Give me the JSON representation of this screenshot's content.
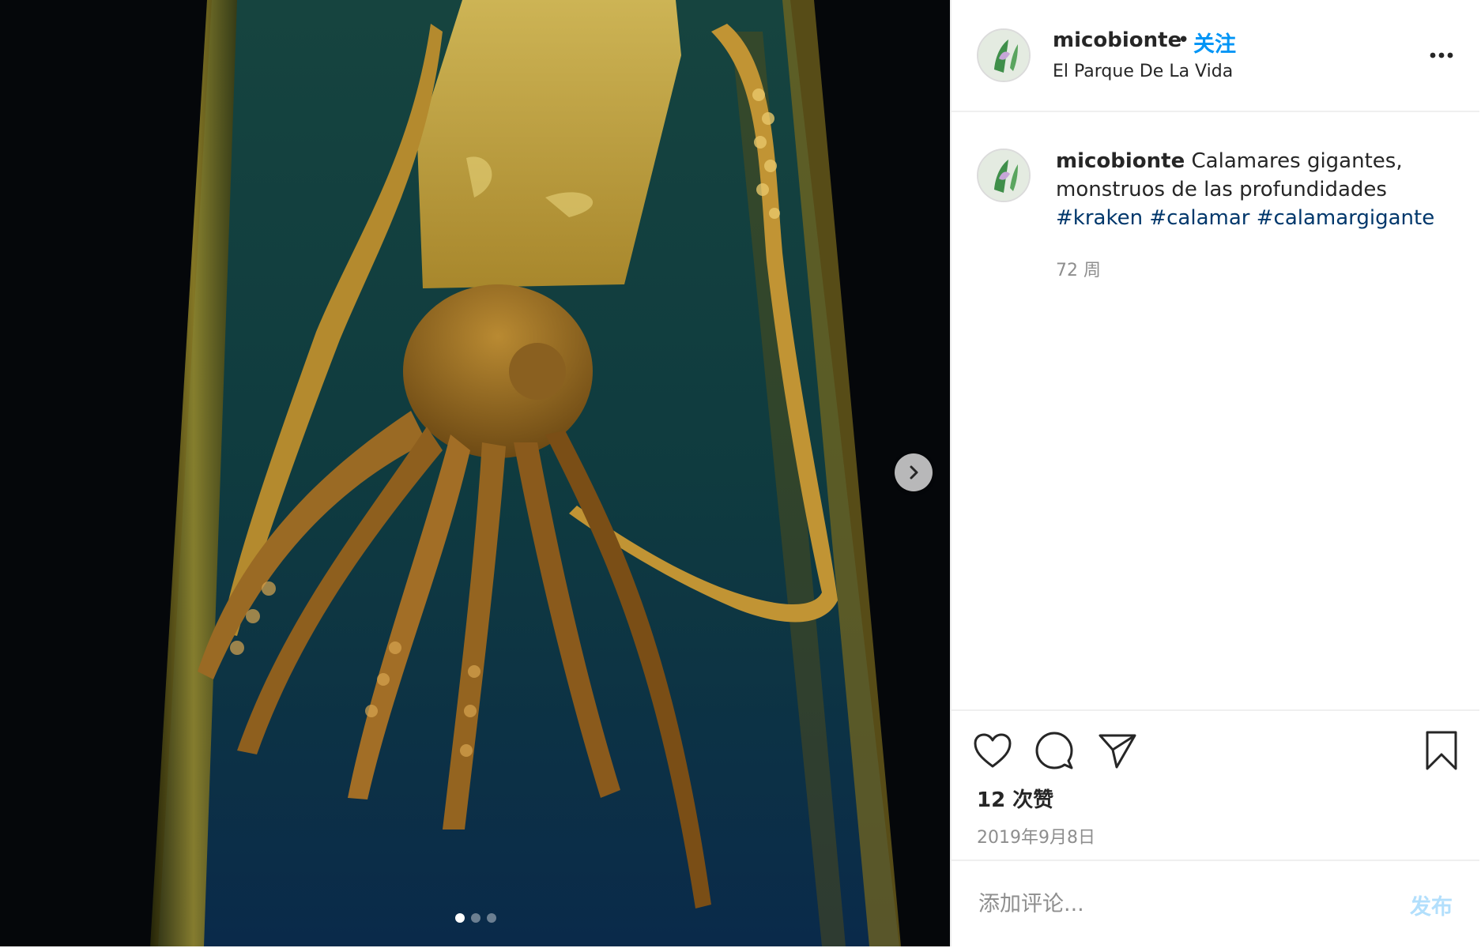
{
  "post": {
    "image_description_icon": "squid-specimen-photo",
    "carousel": {
      "current_index": 1,
      "total": 3
    },
    "next_icon": "chevron-right-icon"
  },
  "header": {
    "username": "micobionte",
    "separator": "•",
    "follow_label": "关注",
    "location": "El Parque De La Vida",
    "more_icon": "more-horizontal-icon"
  },
  "caption": {
    "username": "micobionte",
    "text": "Calamares gigantes, monstruos de las profundidades",
    "hashtags": [
      "#kraken",
      "#calamar",
      "#calamargigante"
    ],
    "age": "72 周"
  },
  "actions": {
    "like_icon": "heart-icon",
    "comment_icon": "comment-icon",
    "share_icon": "paper-plane-icon",
    "save_icon": "bookmark-icon"
  },
  "stats": {
    "likes": "12 次赞",
    "date": "2019年9月8日"
  },
  "comment": {
    "placeholder": "添加评论...",
    "post_label": "发布"
  },
  "colors": {
    "accent": "#0095f6",
    "hashtag": "#00376b",
    "muted": "#8e8e8e",
    "post_disabled": "#b2dffc"
  }
}
